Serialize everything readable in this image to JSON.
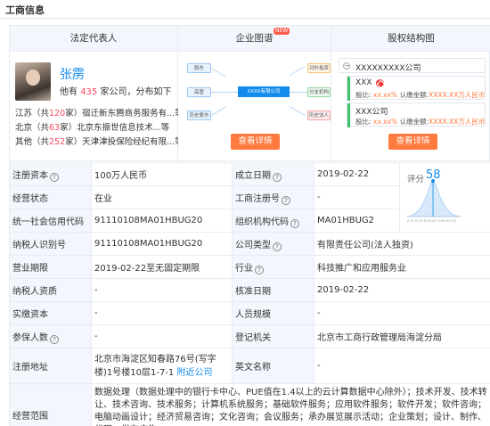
{
  "section": {
    "title": "工商信息"
  },
  "panels": {
    "legal_rep": {
      "header": "法定代表人",
      "name": "张雳",
      "count_prefix": "他有",
      "count": "435",
      "count_suffix": "家公司，分布如下",
      "regions": [
        {
          "region": "江苏（共",
          "num": "120",
          "rest": "家）宿迁新东腾商务服务有...等"
        },
        {
          "region": "北京（共",
          "num": "63",
          "rest": "家）北京东振世信息技术...等"
        },
        {
          "region": "其他（共",
          "num": "252",
          "rest": "家）天津津投保险经纪有限...等"
        }
      ]
    },
    "graph": {
      "header": "企业图谱",
      "new_badge": "NEW",
      "center": "XXXX有限公司",
      "left_nodes": [
        "股东",
        "高管",
        "历史股东"
      ],
      "right_nodes": [
        "对外投资",
        "分支机构",
        "历史法人"
      ],
      "button": "查看详情"
    },
    "equity": {
      "header": "股权结构图",
      "root": "XXXXXXXXX公司",
      "holders": [
        {
          "name": "XXX",
          "ratio_label": "股比:",
          "ratio": "xx.xx%",
          "capital_label": "认缴金额:",
          "capital": "XXXX.XX万人民币"
        },
        {
          "name": "XXX公司",
          "ratio_label": "股比:",
          "ratio": "xx.xx%",
          "capital_label": "认缴金额:",
          "capital": "XXXX.XX万人民币"
        }
      ],
      "button": "查看详情"
    }
  },
  "score": {
    "label": "评分",
    "value": "58",
    "accent": "#128bed"
  },
  "rows": {
    "reg_capital_k": "注册资本",
    "reg_capital_v": "100万人民币",
    "est_date_k": "成立日期",
    "est_date_v": "2019-02-22",
    "status_k": "经营状态",
    "status_v": "在业",
    "reg_no_k": "工商注册号",
    "reg_no_v": "-",
    "credit_k": "统一社会信用代码",
    "credit_v": "91110108MA01HBUG20",
    "org_k": "组织机构代码",
    "org_v": "MA01HBUG2",
    "tax_k": "纳税人识别号",
    "tax_v": "91110108MA01HBUG20",
    "type_k": "公司类型",
    "type_v": "有限责任公司(法人独资)",
    "term_k": "营业期限",
    "term_v": "2019-02-22至无固定期限",
    "industry_k": "行业",
    "industry_v": "科技推广和应用服务业",
    "qual_k": "纳税人资质",
    "qual_v": "-",
    "approve_k": "核准日期",
    "approve_v": "2019-02-22",
    "paid_k": "实缴资本",
    "paid_v": "-",
    "staff_k": "人员规模",
    "staff_v": "-",
    "insured_k": "参保人数",
    "insured_v": "-",
    "authority_k": "登记机关",
    "authority_v": "北京市工商行政管理局海淀分局",
    "addr_k": "注册地址",
    "addr_v": "北京市海淀区知春路76号(写字楼)1号楼10层1-7-1",
    "addr_link": "附近公司",
    "en_k": "英文名称",
    "en_v": "-",
    "scope_k": "经营范围",
    "scope_v": "数据处理（数据处理中的银行卡中心、PUE值在1.4以上的云计算数据中心除外）；技术开发、技术转让、技术咨询、技术服务；计算机系统服务；基础软件服务；应用软件服务；软件开发；软件咨询；电脑动画设计；经济贸易咨询；文化咨询；会议服务；承办展览展示活动；企业策划；设计、制作、代理、发布广告；"
  },
  "help_icon": "question-circle-icon"
}
